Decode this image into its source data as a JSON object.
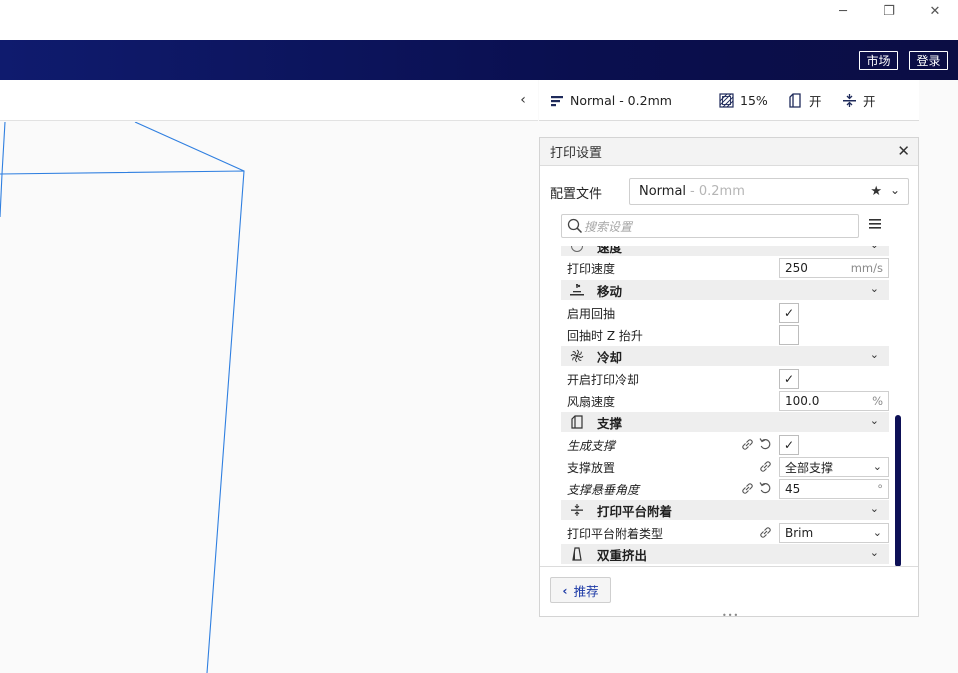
{
  "window": {
    "minimize": "─",
    "maximize": "❐",
    "close": "✕"
  },
  "header": {
    "market_label": "市场",
    "login_label": "登录"
  },
  "stage": {
    "collapse_glyph": "‹"
  },
  "summary": {
    "profile": "Normal - 0.2mm",
    "infill": "15%",
    "support": "开",
    "adhesion": "开"
  },
  "panel": {
    "title": "打印设置",
    "close_glyph": "✕",
    "profile_label": "配置文件",
    "profile_name": "Normal",
    "profile_sub": "- 0.2mm",
    "search_placeholder": "搜索设置",
    "recommended_label": "推荐"
  },
  "settings": {
    "speed_cat": "速度",
    "print_speed_label": "打印速度",
    "print_speed_value": "250",
    "print_speed_unit": "mm/s",
    "travel_cat": "移动",
    "retraction_label": "启用回抽",
    "retraction_checked": true,
    "zhop_label": "回抽时 Z 抬升",
    "zhop_checked": false,
    "cooling_cat": "冷却",
    "cooling_enable_label": "开启打印冷却",
    "cooling_enable_checked": true,
    "fan_speed_label": "风扇速度",
    "fan_speed_value": "100.0",
    "fan_speed_unit": "%",
    "support_cat": "支撑",
    "gen_support_label": "生成支撑",
    "gen_support_checked": true,
    "support_placement_label": "支撑放置",
    "support_placement_value": "全部支撑",
    "overhang_label": "支撑悬垂角度",
    "overhang_value": "45",
    "overhang_unit": "°",
    "adhesion_cat": "打印平台附着",
    "adhesion_type_label": "打印平台附着类型",
    "adhesion_type_value": "Brim",
    "dual_cat": "双重挤出"
  },
  "colors": {
    "header": "#0f1b6e",
    "accent": "#1d3aa6",
    "wire": "#2f7fe0"
  }
}
